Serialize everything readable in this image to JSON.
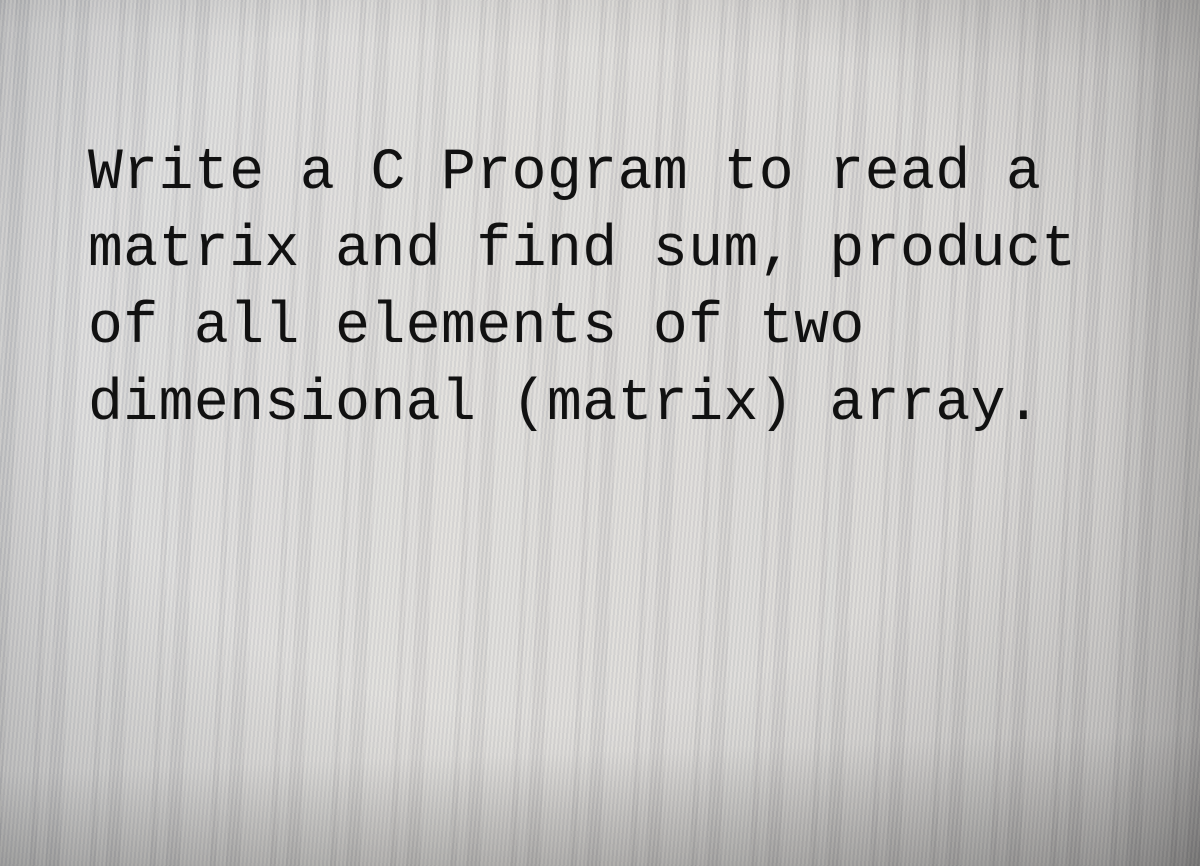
{
  "document": {
    "text": "Write a C Program to read a matrix and find sum, product of all elements of two dimensional (matrix) array."
  }
}
